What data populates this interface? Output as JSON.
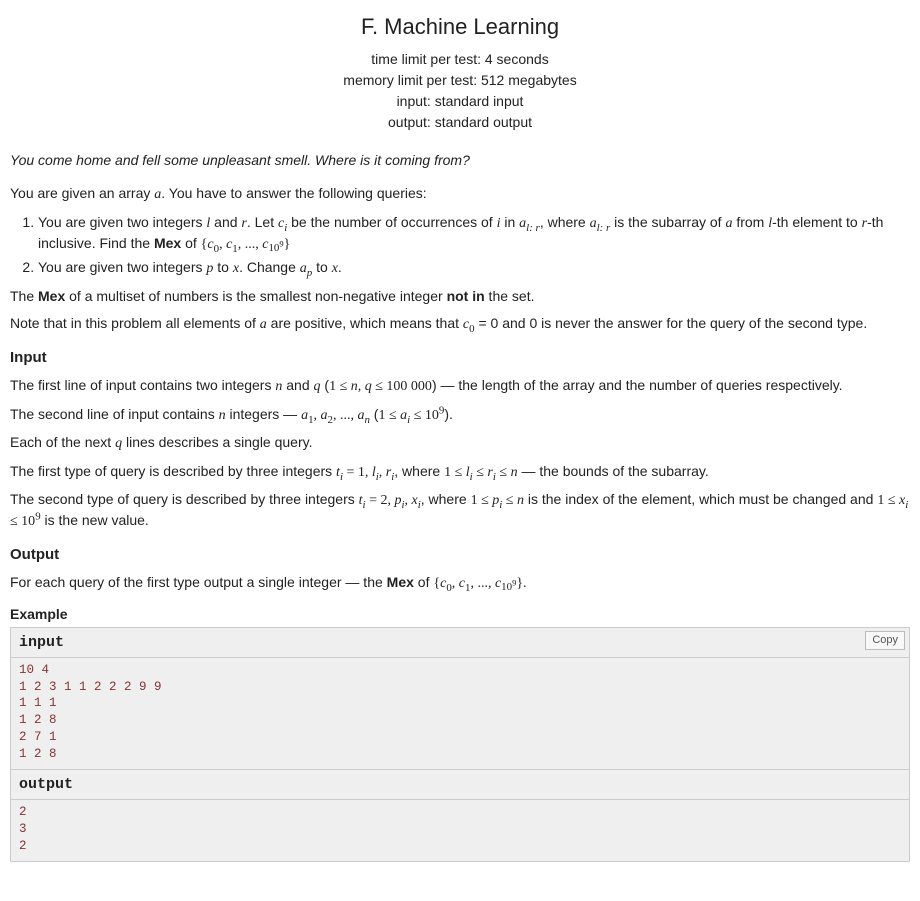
{
  "title": "F. Machine Learning",
  "limits": {
    "time": "time limit per test: 4 seconds",
    "memory": "memory limit per test: 512 megabytes",
    "input": "input: standard input",
    "output": "output: standard output"
  },
  "epigraph": "You come home and fell some unpleasant smell. Where is it coming from?",
  "intro": "You are given an array ",
  "intro2": ". You have to answer the following queries:",
  "q1a": "You are given two integers ",
  "q1b": " and ",
  "q1c": ". Let ",
  "q1d": " be the number of occurrences of ",
  "q1e": " in ",
  "q1f": ", where ",
  "q1g": " is the subarray of ",
  "q1h": " from ",
  "q1i": "-th element to ",
  "q1j": "-th inclusive. Find the ",
  "q1k": " of ",
  "q2a": "You are given two integers ",
  "q2b": " to ",
  "q2c": ". Change ",
  "q2d": " to ",
  "mex_word": "Mex",
  "mex_def1": "The ",
  "mex_def2": " of a multiset of numbers is the smallest non-negative integer ",
  "mex_def3": "not in",
  "mex_def4": " the set.",
  "note1": "Note that in this problem all elements of ",
  "note2": " are positive, which means that ",
  "note3": " = 0 and 0 is never the answer for the query of the second type.",
  "input_title": "Input",
  "in_l1a": "The first line of input contains two integers ",
  "in_l1b": " and ",
  "in_l1c": " (",
  "in_l1d": ") — the length of the array and the number of queries respectively.",
  "in_l2a": "The second line of input contains ",
  "in_l2b": " integers — ",
  "in_l2c": " (",
  "in_l2d": ").",
  "in_l3a": "Each of the next ",
  "in_l3b": " lines describes a single query.",
  "in_l4a": "The first type of query is described by three integers ",
  "in_l4b": ", where ",
  "in_l4c": " — the bounds of the subarray.",
  "in_l5a": "The second type of query is described by three integers ",
  "in_l5b": ", where ",
  "in_l5c": " is the index of the element, which must be changed and ",
  "in_l5d": " is the new value.",
  "output_title": "Output",
  "out_l1a": "For each query of the first type output a single integer  — the ",
  "out_l1b": " of ",
  "example_title": "Example",
  "io": {
    "input_label": "input",
    "output_label": "output",
    "copy": "Copy",
    "input_data": "10 4\n1 2 3 1 1 2 2 2 9 9\n1 1 1\n1 2 8\n2 7 1\n1 2 8",
    "output_data": "2\n3\n2"
  }
}
